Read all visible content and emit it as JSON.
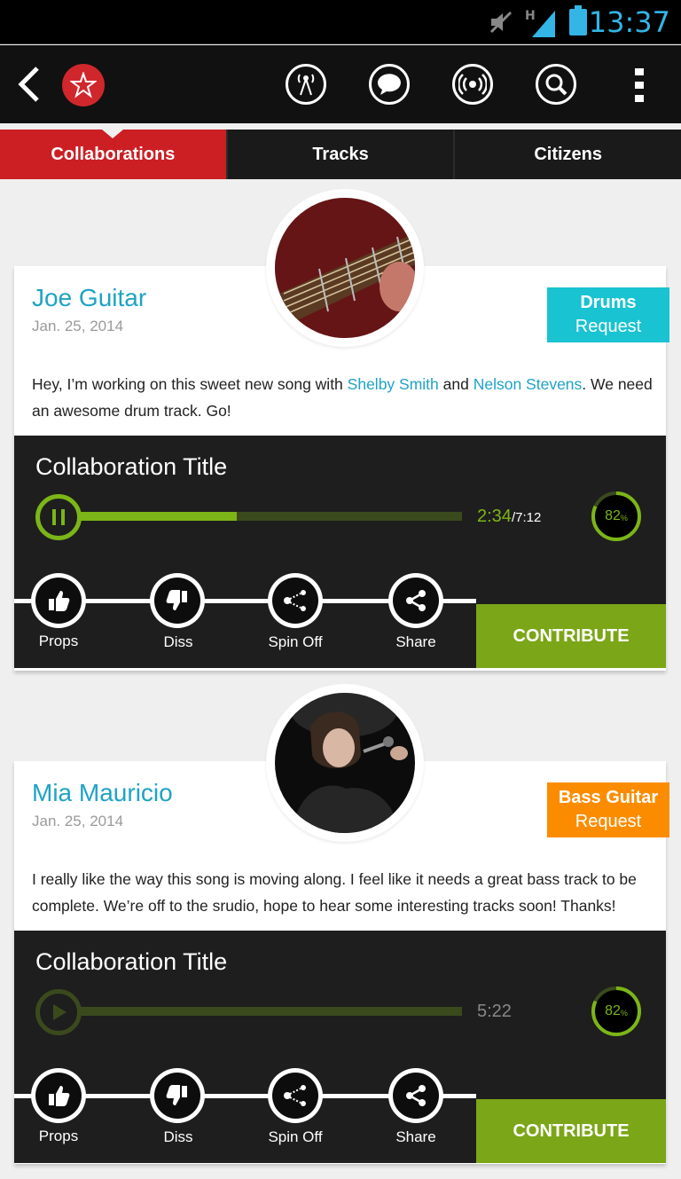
{
  "status_bar": {
    "time": "13:37",
    "network_label": "H"
  },
  "action_bar": {
    "icons": [
      "back-icon",
      "app-logo-icon",
      "radio-tower-icon",
      "chat-bubble-icon",
      "broadcast-icon",
      "search-icon",
      "overflow-menu-icon"
    ]
  },
  "tabs": [
    {
      "label": "Collaborations",
      "active": true
    },
    {
      "label": "Tracks",
      "active": false
    },
    {
      "label": "Citizens",
      "active": false
    }
  ],
  "posts": [
    {
      "author": "Joe Guitar",
      "date": "Jan. 25, 2014",
      "badge_title": "Drums",
      "badge_sub": "Request",
      "badge_color": "#19c3d1",
      "message_parts": {
        "p1": "Hey, I’m working on this sweet new song with ",
        "link1": "Shelby Smith",
        "p2": " and ",
        "link2": "Nelson Stevens",
        "p3": ".  We need an awesome drum track.  Go!"
      },
      "collab_title": "Collaboration Title",
      "player_state": "playing",
      "time_current": "2:34",
      "time_total": "/7:12",
      "progress": 0.43,
      "completion_value": "82",
      "completion_unit": "%",
      "completion_fraction": 0.82,
      "actions": [
        "Props",
        "Diss",
        "Spin Off",
        "Share"
      ],
      "contribute_label": "CONTRIBUTE"
    },
    {
      "author": "Mia Mauricio",
      "date": "Jan. 25, 2014",
      "badge_title": "Bass Guitar",
      "badge_sub": "Request",
      "badge_color": "#fb8c00",
      "message": "I really like the way this song is moving along.  I feel like it needs a great bass track to be complete.  We’re off to the srudio, hope to hear some interesting tracks soon!  Thanks!",
      "collab_title": "Collaboration Title",
      "player_state": "paused",
      "time_total": "5:22",
      "progress": 0,
      "completion_value": "82",
      "completion_unit": "%",
      "completion_fraction": 0.82,
      "actions": [
        "Props",
        "Diss",
        "Spin Off",
        "Share"
      ],
      "contribute_label": "CONTRIBUTE"
    }
  ],
  "colors": {
    "accent_red": "#cc1f24",
    "accent_green": "#7cb518",
    "link_blue": "#1ea3c5"
  }
}
